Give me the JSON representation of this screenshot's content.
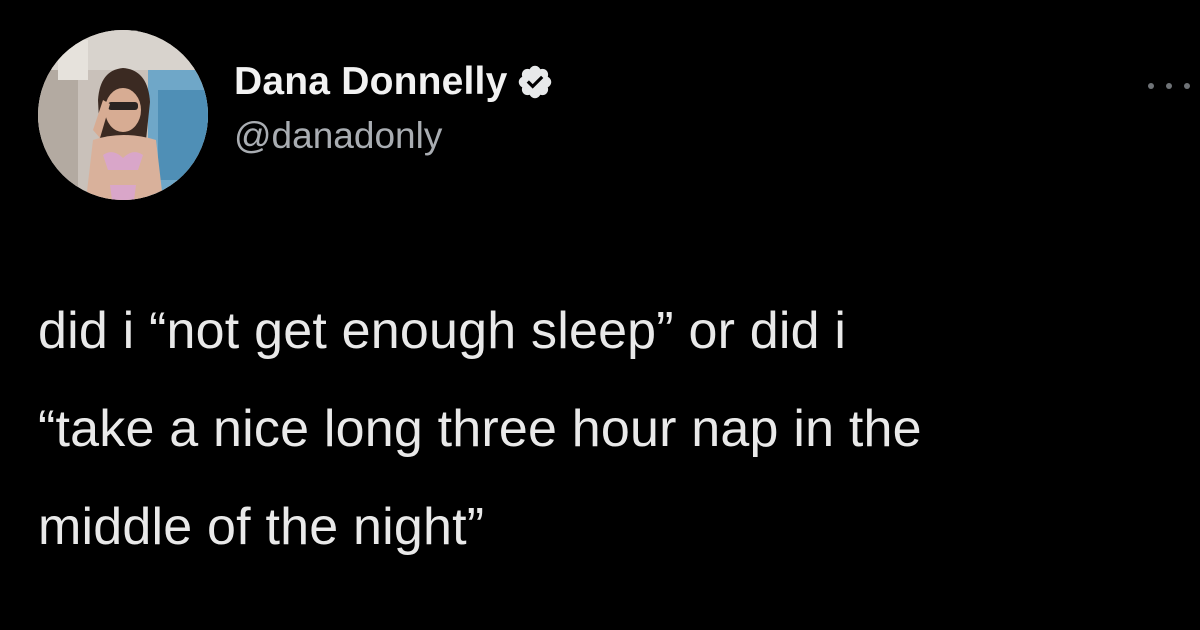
{
  "tweet": {
    "author": {
      "display_name": "Dana Donnelly",
      "handle": "@danadonly",
      "verified": true
    },
    "text_lines": [
      "did i “not get enough sleep” or did i",
      "“take a nice long three hour nap in the",
      "middle of the night”"
    ],
    "icons": {
      "verified": "verified-badge-icon",
      "more": "more-options-icon"
    }
  },
  "colors": {
    "background": "#000000",
    "text": "#e9e9e9",
    "handle": "#a9adb2",
    "verified_badge": "#e7e9ea"
  }
}
